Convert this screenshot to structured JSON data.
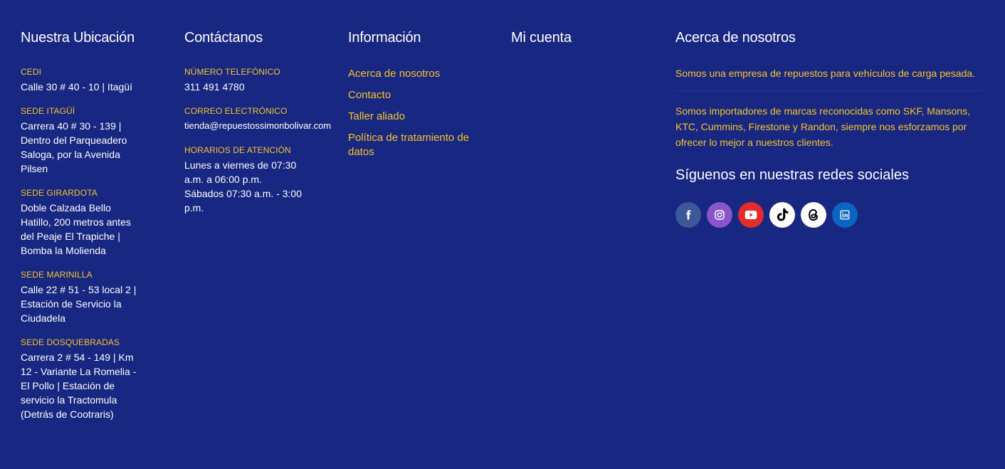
{
  "columns": {
    "ubicacion": {
      "title": "Nuestra Ubicación",
      "groups": [
        {
          "label": "CEDI",
          "text": "Calle 30 # 40 - 10 | Itagüí"
        },
        {
          "label": "SEDE ITAGÜÍ",
          "text": "Carrera 40 # 30 - 139 | Dentro del Parqueadero Saloga, por la Avenida Pilsen"
        },
        {
          "label": "SEDE GIRARDOTA",
          "text": "Doble Calzada Bello Hatillo, 200 metros antes del Peaje El Trapiche | Bomba la Molienda"
        },
        {
          "label": "SEDE MARINILLA",
          "text": "Calle 22 # 51 - 53 local 2 | Estación de Servicio la Ciudadela"
        },
        {
          "label": "SEDE DOSQUEBRADAS",
          "text": "Carrera 2 # 54 - 149 | Km 12 - Variante La Romelia - El Pollo | Estación de servicio la Tractomula (Detrás de Cootraris)"
        }
      ]
    },
    "contacto": {
      "title": "Contáctanos",
      "groups": [
        {
          "label": "NÚMERO TELEFÓNICO",
          "text": "311 491 4780"
        },
        {
          "label": "CORREO ELECTRÓNICO",
          "text": "tienda@repuestossimonbolivar.com"
        },
        {
          "label": "HORARIOS DE ATENCIÓN",
          "text": "Lunes a viernes de 07:30 a.m. a 06:00 p.m. Sábados 07:30 a.m. - 3:00 p.m."
        }
      ]
    },
    "informacion": {
      "title": "Información",
      "links": [
        "Acerca de nosotros",
        "Contacto",
        "Taller aliado",
        "Política de tratamiento de datos"
      ]
    },
    "cuenta": {
      "title": "Mi cuenta"
    },
    "acerca": {
      "title": "Acerca de nosotros",
      "p1": "Somos una empresa de repuestos para vehículos de carga pesada.",
      "p2": "Somos importadores de marcas reconocidas como SKF, Mansons, KTC, Cummins, Firestone y Randon, siempre nos esforzamos por ofrecer lo mejor a nuestros clientes.",
      "social_title": "Síguenos en nuestras redes sociales",
      "social": [
        {
          "icon": "facebook-icon",
          "color": "#3b5998"
        },
        {
          "icon": "instagram-icon",
          "color": "#8a55c8"
        },
        {
          "icon": "youtube-icon",
          "color": "#e62b2b"
        },
        {
          "icon": "tiktok-icon",
          "color": "#ffffff"
        },
        {
          "icon": "threads-icon",
          "color": "#ffffff"
        },
        {
          "icon": "linkedin-icon",
          "color": "#0a66c2"
        }
      ]
    }
  },
  "colors": {
    "background": "#182781",
    "accent": "#f6c42c",
    "text": "#ffffff"
  }
}
